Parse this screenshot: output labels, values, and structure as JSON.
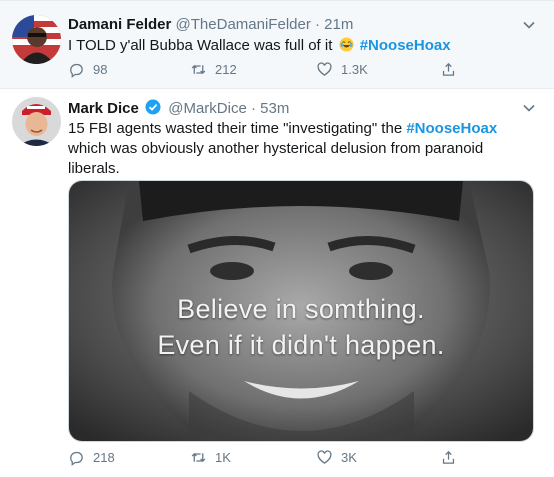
{
  "tweets": [
    {
      "name": "Damani Felder",
      "handle": "@TheDamaniFelder",
      "separator": "·",
      "time": "21m",
      "text_before": "I TOLD y'all Bubba Wallace was full of it",
      "emoji_name": "laughing-face-icon",
      "hashtag": "#NooseHoax",
      "replies": "98",
      "retweets": "212",
      "likes": "1.3K"
    },
    {
      "name": "Mark Dice",
      "verified_icon": "verified-badge-icon",
      "handle": "@MarkDice",
      "separator": "·",
      "time": "53m",
      "text_before": "15 FBI agents wasted their time \"investigating\" the",
      "hashtag": "#NooseHoax",
      "text_after": "which was obviously another hysterical delusion from paranoid liberals.",
      "media": {
        "line1": "Believe in somthing.",
        "line2": "Even if it didn't happen."
      },
      "replies": "218",
      "retweets": "1K",
      "likes": "3K"
    }
  ],
  "colors": {
    "accent": "#1b95e0",
    "muted": "#657786",
    "text": "#14171a",
    "highlight_bg": "#f5f8fa"
  }
}
